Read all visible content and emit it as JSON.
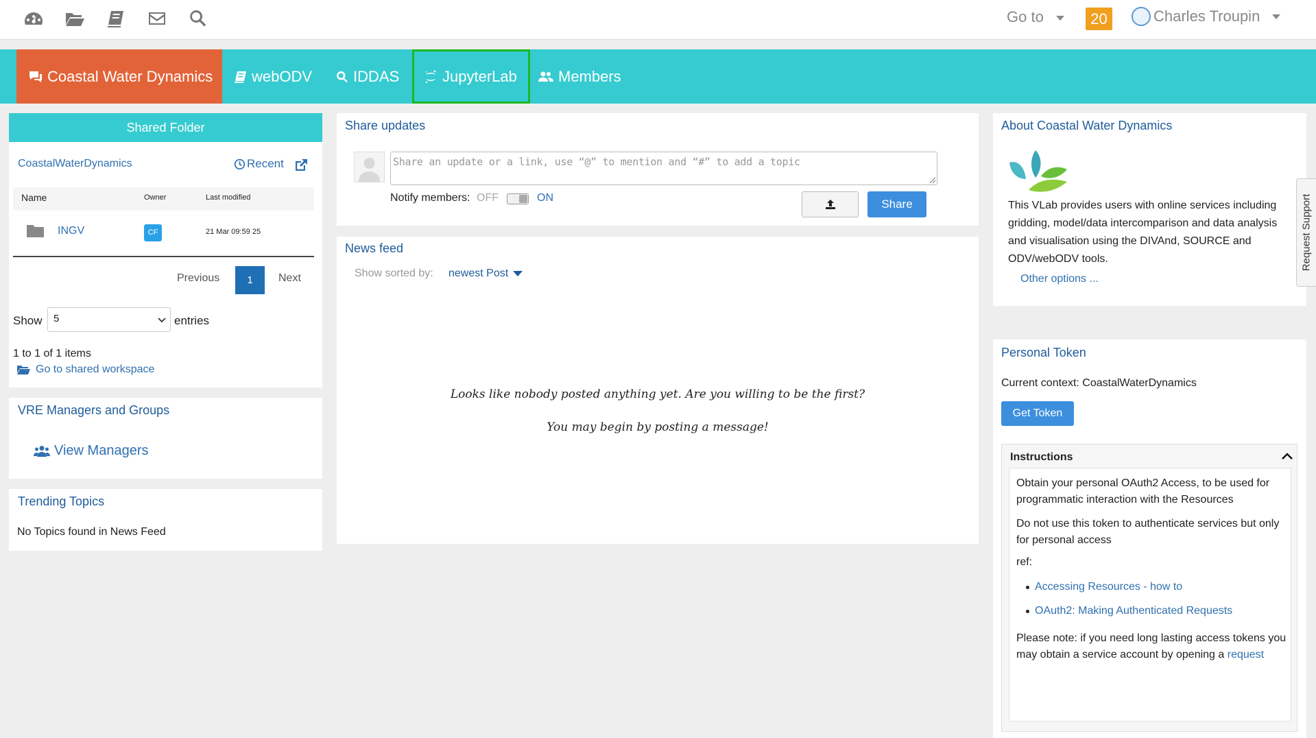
{
  "topbar": {
    "icons": [
      "dashboard-icon",
      "folder-open-icon",
      "book-icon",
      "envelope-icon",
      "search-icon"
    ],
    "goto_label": "Go to",
    "notifications_count": "20",
    "user_name": "Charles Troupin"
  },
  "navbar": {
    "items": [
      {
        "label": "Coastal Water Dynamics",
        "icon": "comments-icon",
        "active": true
      },
      {
        "label": "webODV",
        "icon": "book-icon"
      },
      {
        "label": "IDDAS",
        "icon": "search-icon"
      },
      {
        "label": "JupyterLab",
        "icon": "jupyter-icon",
        "highlighted": true
      },
      {
        "label": "Members",
        "icon": "users-icon"
      }
    ],
    "active_color": "#e36339",
    "bar_color": "#35cbd0",
    "highlight_color": "#1bb923"
  },
  "shared_folder": {
    "title": "Shared Folder",
    "folder_name": "CoastalWaterDynamics",
    "recent_label": "Recent",
    "columns": [
      "Name",
      "Owner",
      "Last modified"
    ],
    "rows": [
      {
        "name": "INGV",
        "owner": "CF",
        "modified": "21 Mar 09:59 25"
      }
    ],
    "prev_label": "Previous",
    "page": "1",
    "next_label": "Next",
    "show_label": "Show",
    "show_value": "5",
    "entries_label": "entries",
    "count_text": "1 to 1 of 1 items",
    "goto_workspace": "Go to shared workspace"
  },
  "vre": {
    "title": "VRE Managers and Groups",
    "view_managers": "View Managers"
  },
  "trending": {
    "title": "Trending Topics",
    "empty": "No Topics found in News Feed"
  },
  "share": {
    "title": "Share updates",
    "placeholder": "Share an update or a link, use “@” to mention and “#” to add a topic",
    "notify_label": "Notify members:",
    "off_label": "OFF",
    "on_label": "ON",
    "share_button": "Share"
  },
  "news": {
    "title": "News feed",
    "sorted_label": "Show sorted by:",
    "sorted_value": "newest Post",
    "empty_line1": "Looks like nobody posted anything yet. Are you willing to be the first?",
    "empty_line2": "You may begin by posting a message!"
  },
  "about": {
    "title": "About Coastal Water Dynamics",
    "text": "This VLab provides users with online services including gridding, model/data intercomparison and data analysis and visualisation using the DIVAnd, SOURCE and ODV/webODV tools.",
    "other_options": "Other options ..."
  },
  "token": {
    "title": "Personal Token",
    "context": "Current context: CoastalWaterDynamics",
    "get_token": "Get Token",
    "instructions_title": "Instructions",
    "p1": "Obtain your personal OAuth2 Access, to be used for programmatic interaction with the Resources",
    "p2": "Do not use this token to authenticate services but only for personal access",
    "ref": "ref:",
    "links": [
      "Accessing Resources - how to",
      "OAuth2: Making Authenticated Requests"
    ],
    "note": "Please note: if you need long lasting access tokens you may obtain a service account by opening a",
    "note_link": "request"
  },
  "side_tab": {
    "label": "Request Support"
  }
}
